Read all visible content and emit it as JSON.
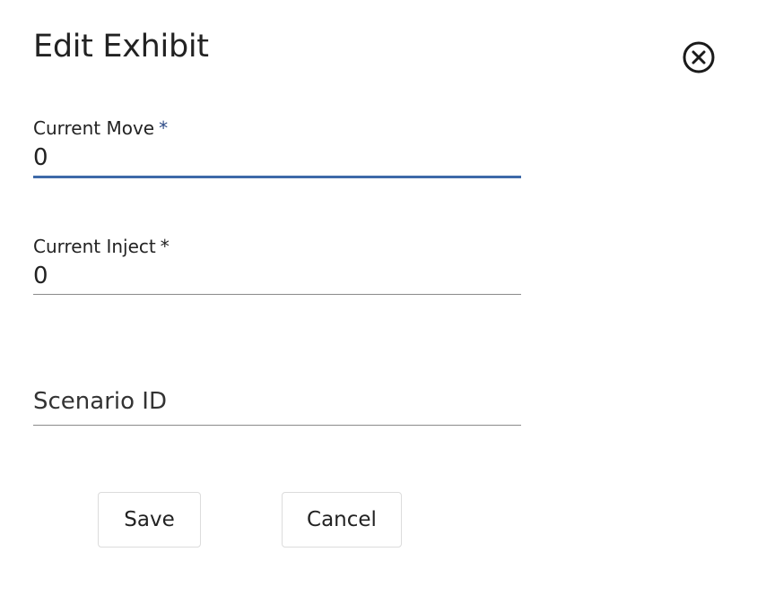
{
  "dialog": {
    "title": "Edit Exhibit",
    "close_icon": "close-circle-icon"
  },
  "fields": {
    "current_move": {
      "label": "Current Move",
      "required_marker": "*",
      "value": "0",
      "focused": true
    },
    "current_inject": {
      "label": "Current Inject",
      "required_marker": "*",
      "value": "0"
    },
    "scenario_id": {
      "placeholder": "Scenario ID",
      "value": ""
    }
  },
  "actions": {
    "save_label": "Save",
    "cancel_label": "Cancel"
  },
  "colors": {
    "focus_underline": "#3e6aa9",
    "required_marker_active": "#2c4a86",
    "text": "#222222"
  }
}
